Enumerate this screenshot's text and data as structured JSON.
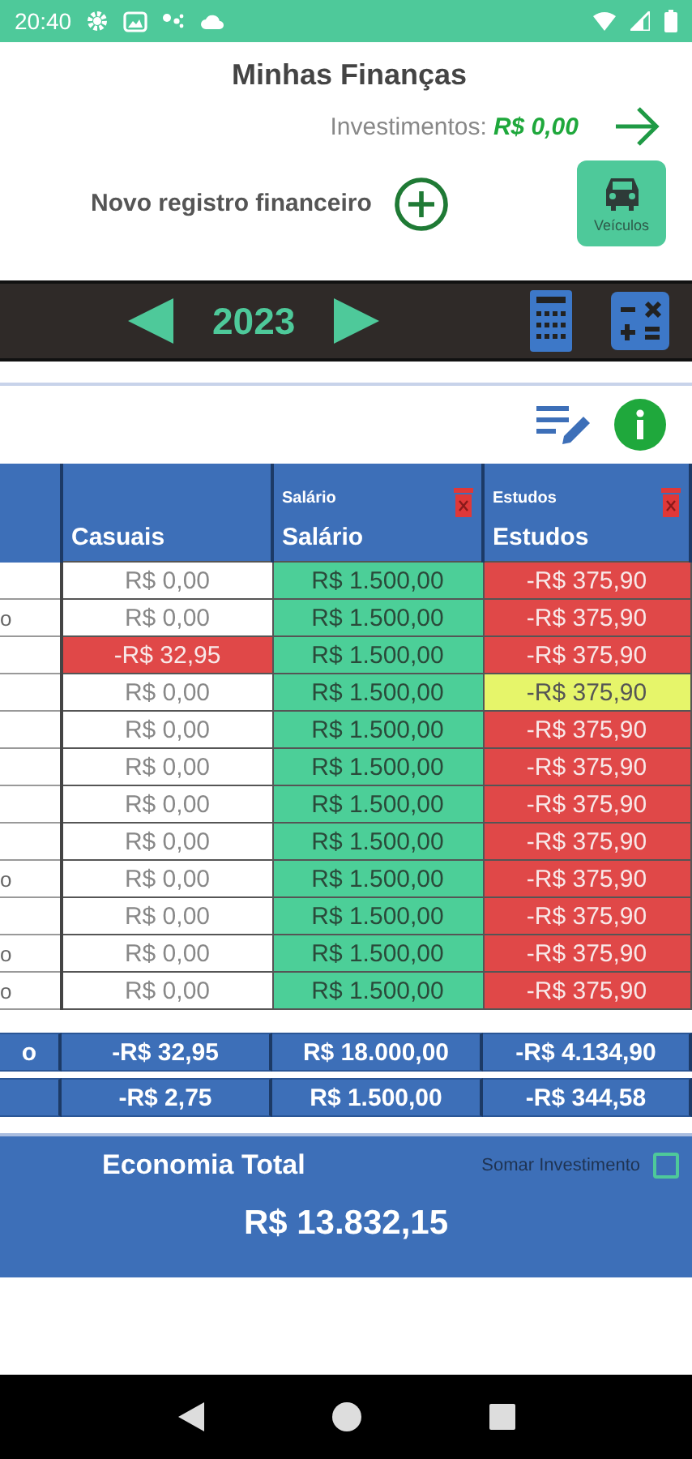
{
  "status_bar": {
    "time": "20:40"
  },
  "header": {
    "title": "Minhas Finanças",
    "investments_label": "Investimentos:",
    "investments_value": "R$ 0,00",
    "new_record_label": "Novo registro financeiro",
    "vehicles_button": "Veículos"
  },
  "year_bar": {
    "year": "2023"
  },
  "table": {
    "columns": [
      {
        "label": "Casuais"
      },
      {
        "tag": "Salário",
        "label": "Salário",
        "deletable": true
      },
      {
        "tag": "Estudos",
        "label": "Estudos",
        "deletable": true
      }
    ],
    "rows": [
      {
        "cells": [
          {
            "value": "R$ 0,00",
            "color": "#ffffff"
          },
          {
            "value": "R$ 1.500,00",
            "color": "#4ccf98"
          },
          {
            "value": "-R$ 375,90",
            "color": "#e04848"
          }
        ]
      },
      {
        "label": "o",
        "cells": [
          {
            "value": "R$ 0,00",
            "color": "#ffffff"
          },
          {
            "value": "R$ 1.500,00",
            "color": "#4ccf98"
          },
          {
            "value": "-R$ 375,90",
            "color": "#e04848"
          }
        ]
      },
      {
        "cells": [
          {
            "value": "-R$ 32,95",
            "color": "#e04848"
          },
          {
            "value": "R$ 1.500,00",
            "color": "#4ccf98"
          },
          {
            "value": "-R$ 375,90",
            "color": "#e04848"
          }
        ]
      },
      {
        "cells": [
          {
            "value": "R$ 0,00",
            "color": "#ffffff"
          },
          {
            "value": "R$ 1.500,00",
            "color": "#4ccf98"
          },
          {
            "value": "-R$ 375,90",
            "color": "#e6f56a"
          }
        ]
      },
      {
        "cells": [
          {
            "value": "R$ 0,00",
            "color": "#ffffff"
          },
          {
            "value": "R$ 1.500,00",
            "color": "#4ccf98"
          },
          {
            "value": "-R$ 375,90",
            "color": "#e04848"
          }
        ]
      },
      {
        "cells": [
          {
            "value": "R$ 0,00",
            "color": "#ffffff"
          },
          {
            "value": "R$ 1.500,00",
            "color": "#4ccf98"
          },
          {
            "value": "-R$ 375,90",
            "color": "#e04848"
          }
        ]
      },
      {
        "cells": [
          {
            "value": "R$ 0,00",
            "color": "#ffffff"
          },
          {
            "value": "R$ 1.500,00",
            "color": "#4ccf98"
          },
          {
            "value": "-R$ 375,90",
            "color": "#e04848"
          }
        ]
      },
      {
        "cells": [
          {
            "value": "R$ 0,00",
            "color": "#ffffff"
          },
          {
            "value": "R$ 1.500,00",
            "color": "#4ccf98"
          },
          {
            "value": "-R$ 375,90",
            "color": "#e04848"
          }
        ]
      },
      {
        "label": "o",
        "cells": [
          {
            "value": "R$ 0,00",
            "color": "#ffffff"
          },
          {
            "value": "R$ 1.500,00",
            "color": "#4ccf98"
          },
          {
            "value": "-R$ 375,90",
            "color": "#e04848"
          }
        ]
      },
      {
        "cells": [
          {
            "value": "R$ 0,00",
            "color": "#ffffff"
          },
          {
            "value": "R$ 1.500,00",
            "color": "#4ccf98"
          },
          {
            "value": "-R$ 375,90",
            "color": "#e04848"
          }
        ]
      },
      {
        "label": "o",
        "cells": [
          {
            "value": "R$ 0,00",
            "color": "#ffffff"
          },
          {
            "value": "R$ 1.500,00",
            "color": "#4ccf98"
          },
          {
            "value": "-R$ 375,90",
            "color": "#e04848"
          }
        ]
      },
      {
        "label": "o",
        "cells": [
          {
            "value": "R$ 0,00",
            "color": "#ffffff"
          },
          {
            "value": "R$ 1.500,00",
            "color": "#4ccf98"
          },
          {
            "value": "-R$ 375,90",
            "color": "#e04848"
          }
        ]
      }
    ],
    "summary_rows": [
      {
        "label": "o",
        "values": [
          "-R$ 32,95",
          "R$ 18.000,00",
          "-R$ 4.134,90"
        ]
      },
      {
        "values": [
          "-R$ 2,75",
          "R$ 1.500,00",
          "-R$ 344,58"
        ]
      }
    ]
  },
  "savings": {
    "title": "Economia Total",
    "add_investment": {
      "label": "Somar Investimento",
      "checked": false
    },
    "total": "R$ 13.832,15"
  }
}
